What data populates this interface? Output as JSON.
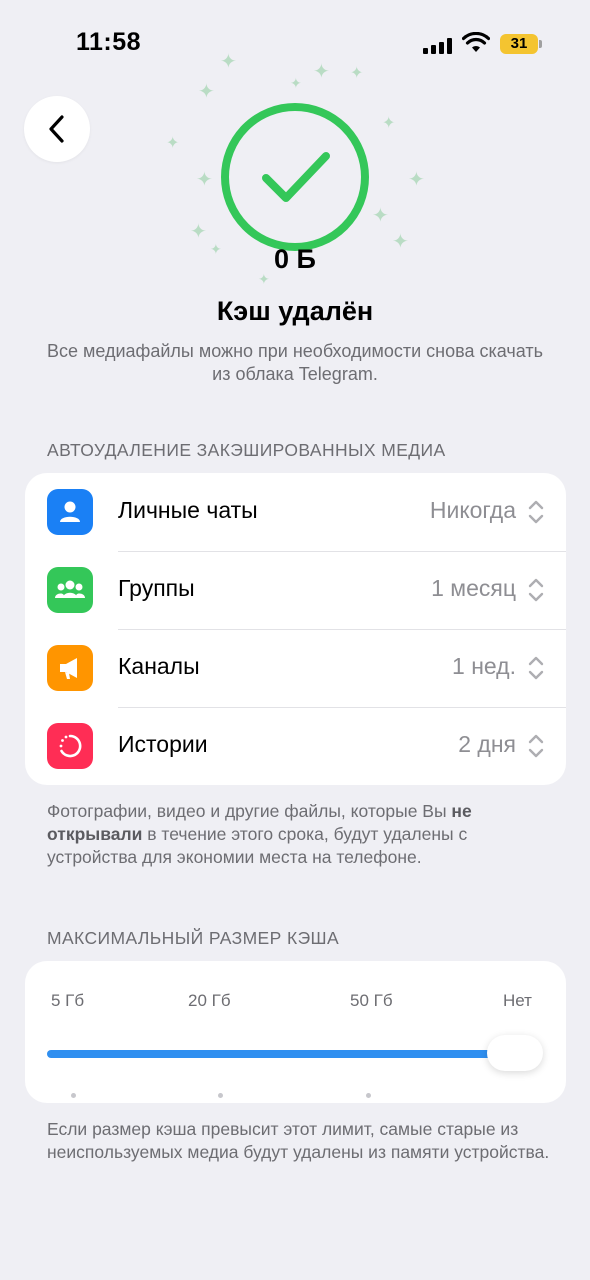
{
  "status_bar": {
    "time": "11:58",
    "battery": "31"
  },
  "nav": {
    "back_icon": "chevron-left-icon"
  },
  "hero": {
    "size": "0 Б",
    "title": "Кэш удалён",
    "subtitle": "Все медиафайлы можно при необходимости снова скачать из облака Telegram."
  },
  "auto_delete": {
    "header": "АВТОУДАЛЕНИЕ ЗАКЭШИРОВАННЫХ МЕДИА",
    "items": [
      {
        "label": "Личные чаты",
        "value": "Никогда",
        "icon": "person-icon",
        "color": "#1a80f5"
      },
      {
        "label": "Группы",
        "value": "1 месяц",
        "icon": "group-icon",
        "color": "#34c759"
      },
      {
        "label": "Каналы",
        "value": "1 нед.",
        "icon": "megaphone-icon",
        "color": "#ff9500"
      },
      {
        "label": "Истории",
        "value": "2 дня",
        "icon": "stories-icon",
        "color": "#ff2d55"
      }
    ],
    "footer_part1": "Фотографии, видео и другие файлы, которые Вы ",
    "footer_bold": "не открывали",
    "footer_part2": " в течение этого срока, будут удалены с устройства для экономии места на телефоне."
  },
  "max_size": {
    "header": "МАКСИМАЛЬНЫЙ РАЗМЕР КЭША",
    "labels": [
      "5 Гб",
      "20 Гб",
      "50 Гб",
      "Нет"
    ],
    "selected_index": 3,
    "footer": "Если размер кэша превысит этот лимит, самые старые из неиспользуемых медиа будут удалены из памяти устройства."
  },
  "colors": {
    "accent": "#2f8ff0",
    "success": "#34c759"
  }
}
